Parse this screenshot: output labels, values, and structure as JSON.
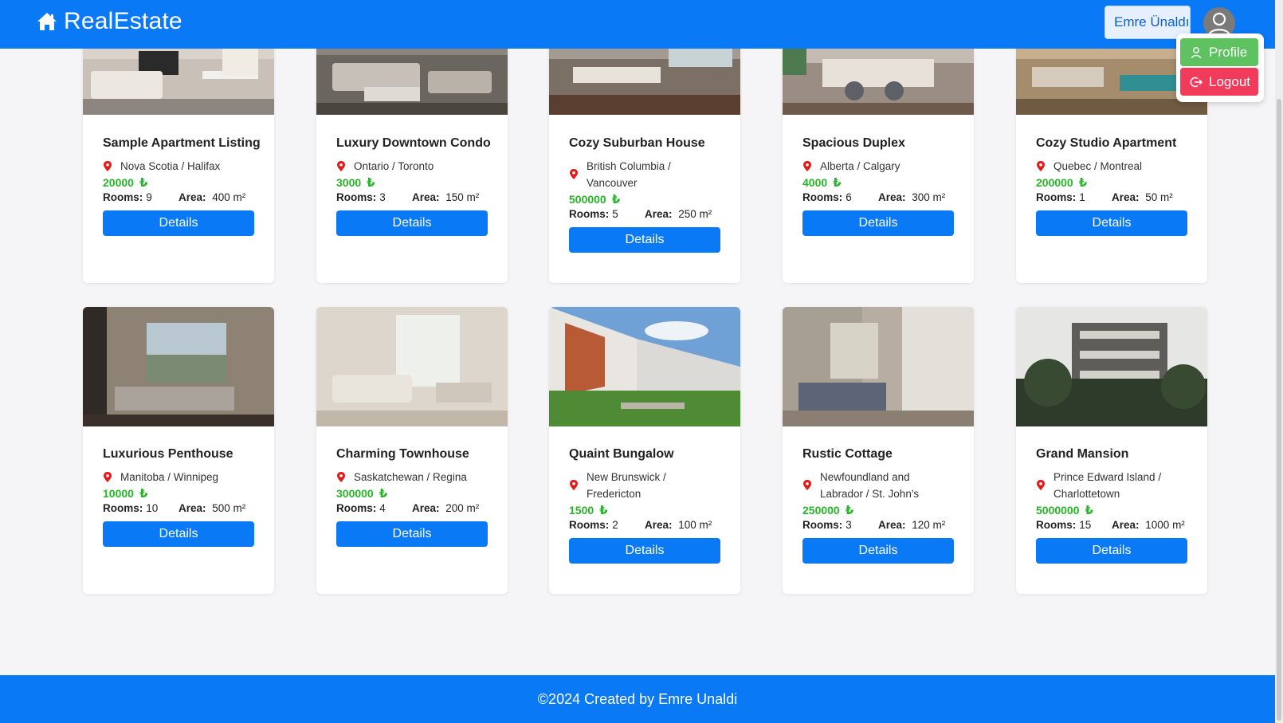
{
  "navbar": {
    "brand": "RealEstate",
    "user_name": "Emre Ünaldı",
    "color": "#0a79f5"
  },
  "user_menu": {
    "profile_label": "Profile",
    "logout_label": "Logout",
    "profile_color": "#5dc25f",
    "logout_color": "#f23a5b"
  },
  "listings": [
    {
      "title": "Sample Apartment Listing",
      "location": "Nova Scotia / Halifax",
      "price": "20000",
      "currency": "₺",
      "rooms_label": "Rooms:",
      "rooms": "9",
      "area_label": "Area:",
      "area": "400 m²",
      "button": "Details"
    },
    {
      "title": "Luxury Downtown Condo",
      "location": "Ontario / Toronto",
      "price": "3000",
      "currency": "₺",
      "rooms_label": "Rooms:",
      "rooms": "3",
      "area_label": "Area:",
      "area": "150 m²",
      "button": "Details"
    },
    {
      "title": "Cozy Suburban House",
      "location": "British Columbia / Vancouver",
      "price": "500000",
      "currency": "₺",
      "rooms_label": "Rooms:",
      "rooms": "5",
      "area_label": "Area:",
      "area": "250 m²",
      "button": "Details"
    },
    {
      "title": "Spacious Duplex",
      "location": "Alberta / Calgary",
      "price": "4000",
      "currency": "₺",
      "rooms_label": "Rooms:",
      "rooms": "6",
      "area_label": "Area:",
      "area": "300 m²",
      "button": "Details"
    },
    {
      "title": "Cozy Studio Apartment",
      "location": "Quebec / Montreal",
      "price": "200000",
      "currency": "₺",
      "rooms_label": "Rooms:",
      "rooms": "1",
      "area_label": "Area:",
      "area": "50 m²",
      "button": "Details"
    },
    {
      "title": "Luxurious Penthouse",
      "location": "Manitoba / Winnipeg",
      "price": "10000",
      "currency": "₺",
      "rooms_label": "Rooms:",
      "rooms": "10",
      "area_label": "Area:",
      "area": "500 m²",
      "button": "Details"
    },
    {
      "title": "Charming Townhouse",
      "location": "Saskatchewan / Regina",
      "price": "300000",
      "currency": "₺",
      "rooms_label": "Rooms:",
      "rooms": "4",
      "area_label": "Area:",
      "area": "200 m²",
      "button": "Details"
    },
    {
      "title": "Quaint Bungalow",
      "location": "New Brunswick / Fredericton",
      "price": "1500",
      "currency": "₺",
      "rooms_label": "Rooms:",
      "rooms": "2",
      "area_label": "Area:",
      "area": "100 m²",
      "button": "Details"
    },
    {
      "title": "Rustic Cottage",
      "location": "Newfoundland and Labrador / St. John's",
      "price": "250000",
      "currency": "₺",
      "rooms_label": "Rooms:",
      "rooms": "3",
      "area_label": "Area:",
      "area": "120 m²",
      "button": "Details"
    },
    {
      "title": "Grand Mansion",
      "location": "Prince Edward Island / Charlottetown",
      "price": "5000000",
      "currency": "₺",
      "rooms_label": "Rooms:",
      "rooms": "15",
      "area_label": "Area:",
      "area": "1000 m²",
      "button": "Details"
    }
  ],
  "footer": {
    "text": "©2024 Created by Emre Unaldi"
  }
}
